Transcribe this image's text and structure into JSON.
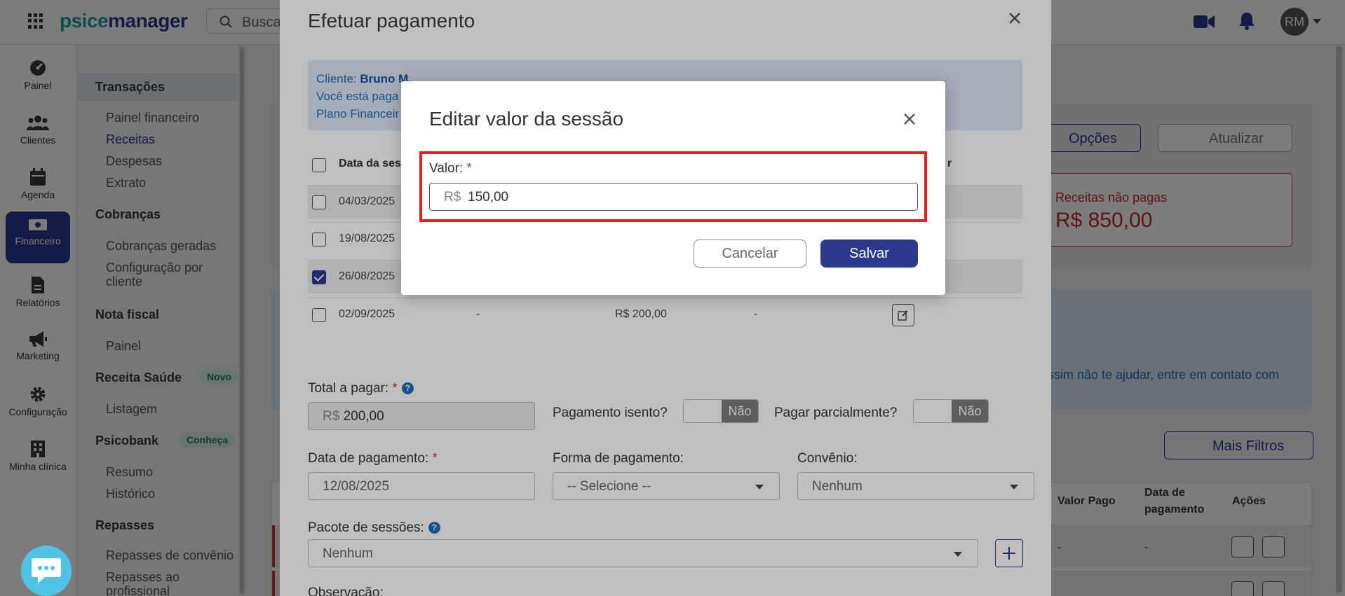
{
  "topbar": {
    "logo_part1": "psice",
    "logo_part2": "manager",
    "search_placeholder": "Busca",
    "avatar_initials": "RM"
  },
  "rail": {
    "items": [
      {
        "label": "Painel",
        "icon": "dashboard-icon"
      },
      {
        "label": "Clientes",
        "icon": "users-icon"
      },
      {
        "label": "Agenda",
        "icon": "calendar-icon"
      },
      {
        "label": "Financeiro",
        "icon": "money-icon"
      },
      {
        "label": "Relatórios",
        "icon": "document-icon"
      },
      {
        "label": "Marketing",
        "icon": "megaphone-icon"
      },
      {
        "label": "Configuração",
        "icon": "gear-icon"
      },
      {
        "label": "Minha clínica",
        "icon": "building-icon"
      }
    ]
  },
  "subnav": {
    "transacoes": "Transações",
    "painel_financeiro": "Painel financeiro",
    "receitas": "Receitas",
    "despesas": "Despesas",
    "extrato": "Extrato",
    "cobrancas": "Cobranças",
    "cobrancas_geradas": "Cobranças geradas",
    "configuracao_cliente": "Configuração por cliente",
    "nota_fiscal": "Nota fiscal",
    "nf_painel": "Painel",
    "receita_saude": "Receita Saúde",
    "badge_novo": "Novo",
    "listagem": "Listagem",
    "psicobank": "Psicobank",
    "badge_conheca": "Conheça",
    "resumo": "Resumo",
    "historico": "Histórico",
    "repasses": "Repasses",
    "repasses_convenio": "Repasses de convênio",
    "repasses_profissional": "Repasses ao profissional"
  },
  "background": {
    "opcoes": "Opções",
    "atualizar": "Atualizar",
    "unpaid_label": "Receitas não pagas",
    "unpaid_value": "R$ 850,00",
    "info_text": "ssim não te ajudar, entre em contato com",
    "mais_filtros": "Mais Filtros",
    "col_valor_pago": "Valor Pago",
    "col_data_pagamento": "Data de pagamento",
    "col_acoes": "Ações",
    "row1_a": "-",
    "row1_b": "-"
  },
  "payment_modal": {
    "title": "Efetuar pagamento",
    "info_cliente_label": "Cliente: ",
    "info_cliente_name": "Bruno M.",
    "info_line2": "Você está paga",
    "info_line3": "Plano Financeir",
    "col_data": "Data da sess",
    "col_last": "r",
    "rows": [
      {
        "date": "04/03/2025",
        "c2": "",
        "c3": "",
        "c4": "",
        "checked": false
      },
      {
        "date": "19/08/2025",
        "c2": "",
        "c3": "",
        "c4": "",
        "checked": false
      },
      {
        "date": "26/08/2025",
        "c2": "",
        "c3": "",
        "c4": "",
        "checked": true
      },
      {
        "date": "02/09/2025",
        "c2": "-",
        "c3": "R$ 200,00",
        "c4": "-",
        "checked": false
      }
    ],
    "total_label": "Total a pagar:",
    "total_currency": "R$",
    "total_value": "200,00",
    "isento_label": "Pagamento isento?",
    "isento_value": "Não",
    "parcial_label": "Pagar parcialmente?",
    "parcial_value": "Não",
    "data_pagamento_label": "Data de pagamento:",
    "data_pagamento_value": "12/08/2025",
    "forma_label": "Forma de pagamento:",
    "forma_value": "-- Selecione --",
    "convenio_label": "Convênio:",
    "convenio_value": "Nenhum",
    "pacote_label": "Pacote de sessões:",
    "pacote_value": "Nenhum",
    "observacao_label": "Observação:"
  },
  "edit_modal": {
    "title": "Editar valor da sessão",
    "valor_label": "Valor:",
    "required_mark": "*",
    "currency": "R$",
    "value": "150,00",
    "cancel_label": "Cancelar",
    "save_label": "Salvar"
  },
  "colors": {
    "primary": "#2b3a8c",
    "teal": "#1aa39a",
    "danger": "#e2231a",
    "info_bg": "#dbe7f6"
  }
}
